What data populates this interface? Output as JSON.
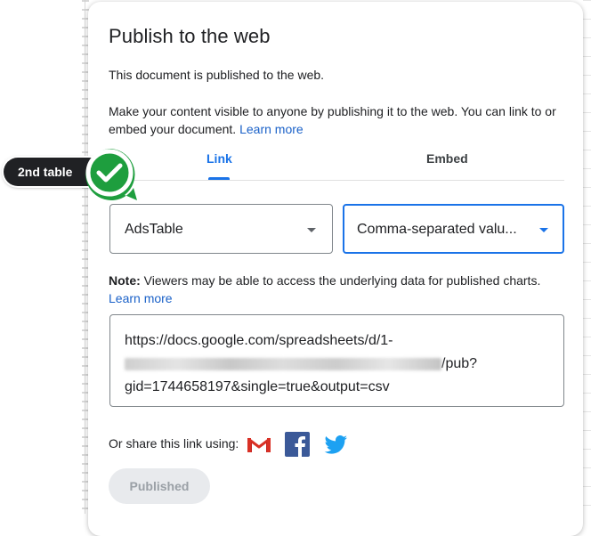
{
  "dialog": {
    "title": "Publish to the web",
    "published_message": "This document is published to the web.",
    "info_text": "Make your content visible to anyone by publishing it to the web. You can link to or embed your document.",
    "learn_more": "Learn more"
  },
  "tabs": [
    {
      "label": "Link",
      "active": true
    },
    {
      "label": "Embed",
      "active": false
    }
  ],
  "table_select": {
    "value": "AdsTable"
  },
  "format_select": {
    "value": "Comma-separated valu..."
  },
  "note": {
    "label": "Note:",
    "text": "Viewers may be able to access the underlying data for published charts.",
    "learn_more": "Learn more"
  },
  "url": {
    "line1": "https://docs.google.com/spreadsheets/d/1-",
    "line2_suffix": "/pub?",
    "line3": "gid=1744658197&single=true&output=csv"
  },
  "share": {
    "label": "Or share this link using:",
    "icons": [
      "gmail-icon",
      "facebook-icon",
      "twitter-icon"
    ]
  },
  "published_button": {
    "label": "Published",
    "enabled": false
  },
  "annotation": {
    "label": "2nd table",
    "icon": "checkmark-icon"
  },
  "colors": {
    "accent": "#1a73e8",
    "link": "#1a61c8",
    "annotation_green": "#1e9e3e"
  }
}
